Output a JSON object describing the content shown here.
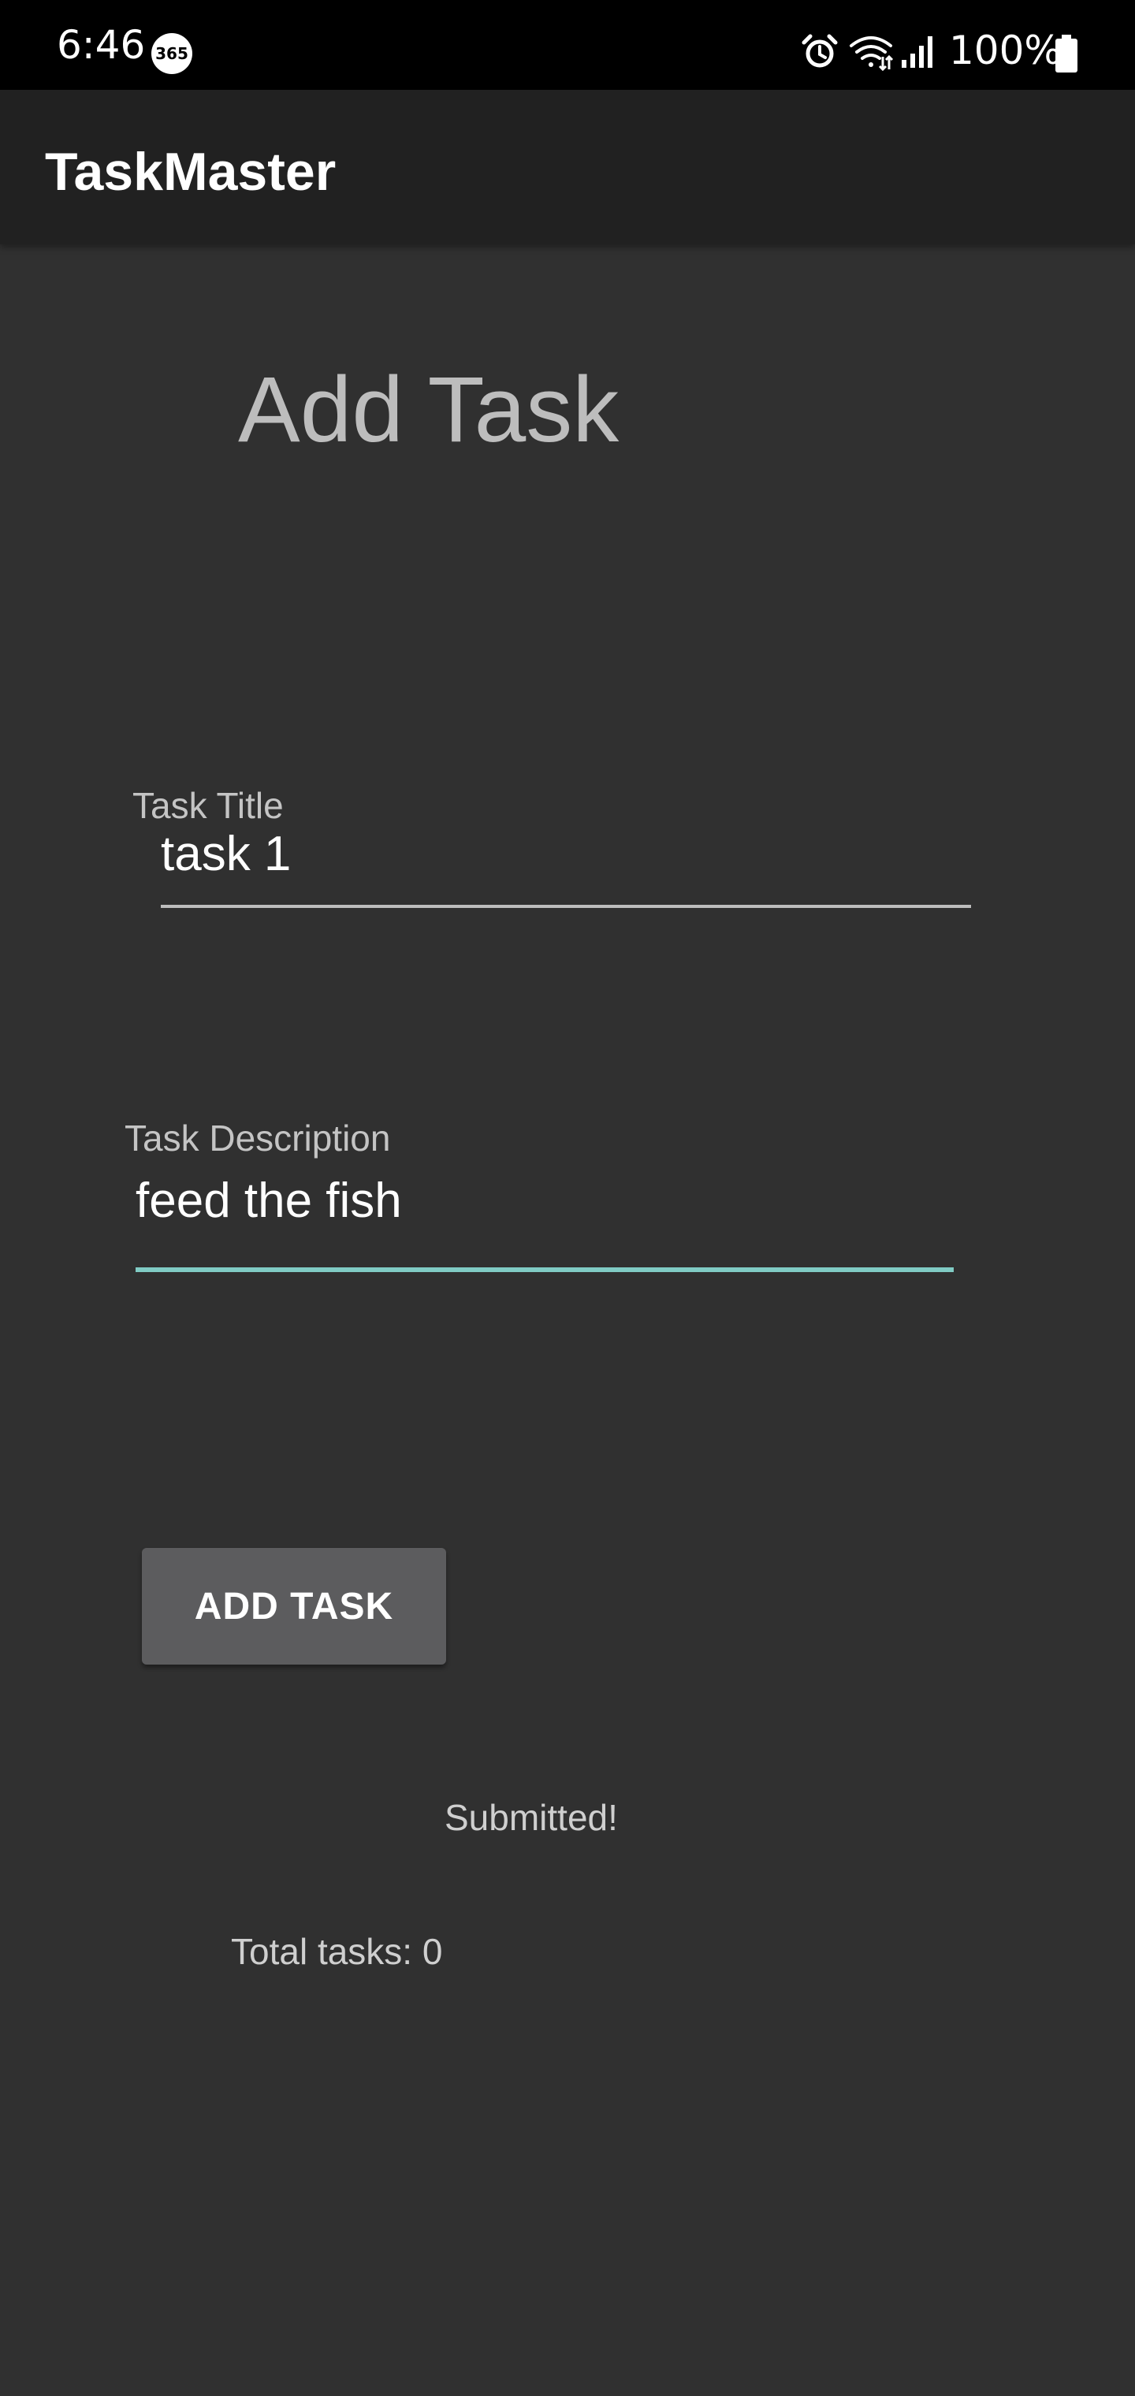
{
  "status_bar": {
    "time": "6:46",
    "notification_badge": "365",
    "battery_percent": "100%",
    "icons": [
      "alarm-icon",
      "wifi-icon",
      "signal-icon",
      "battery-icon"
    ]
  },
  "app_bar": {
    "title": "TaskMaster"
  },
  "form": {
    "heading": "Add Task",
    "title_field": {
      "label": "Task Title",
      "value": "task 1"
    },
    "description_field": {
      "label": "Task Description",
      "value": "feed the fish"
    },
    "submit_label": "ADD TASK",
    "status_message": "Submitted!",
    "task_count_text": "Total tasks: 0"
  },
  "colors": {
    "background": "#303030",
    "status_bar": "#000000",
    "app_bar": "#212121",
    "accent": "#80cbc4",
    "button": "#5c5c5e",
    "heading_text": "#bdbdbd"
  }
}
